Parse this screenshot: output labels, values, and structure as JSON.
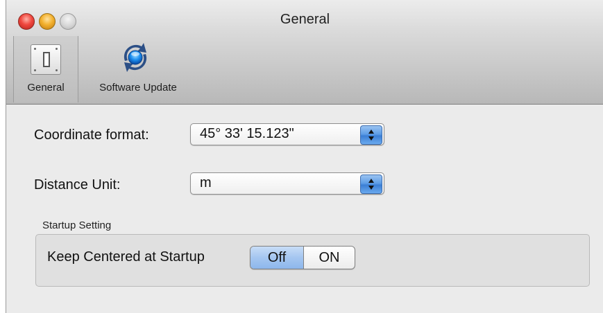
{
  "window": {
    "title": "General"
  },
  "toolbar": {
    "items": [
      {
        "label": "General",
        "icon": "light-switch-icon",
        "selected": true
      },
      {
        "label": "Software Update",
        "icon": "refresh-sync-icon",
        "selected": false
      }
    ]
  },
  "coordinate": {
    "label": "Coordinate format:",
    "value": "45° 33' 15.123\""
  },
  "distance": {
    "label": "Distance Unit:",
    "value": "m"
  },
  "startup": {
    "group_label": "Startup Setting",
    "keep_label": "Keep Centered at Startup",
    "off_label": "Off",
    "on_label": "ON",
    "selected": "Off"
  },
  "colors": {
    "popup_arrow_blue": "#4f8fe0",
    "segment_selected": "#a5c6f0",
    "close_button": "#f0473e",
    "minimize_button": "#f3b12f"
  }
}
